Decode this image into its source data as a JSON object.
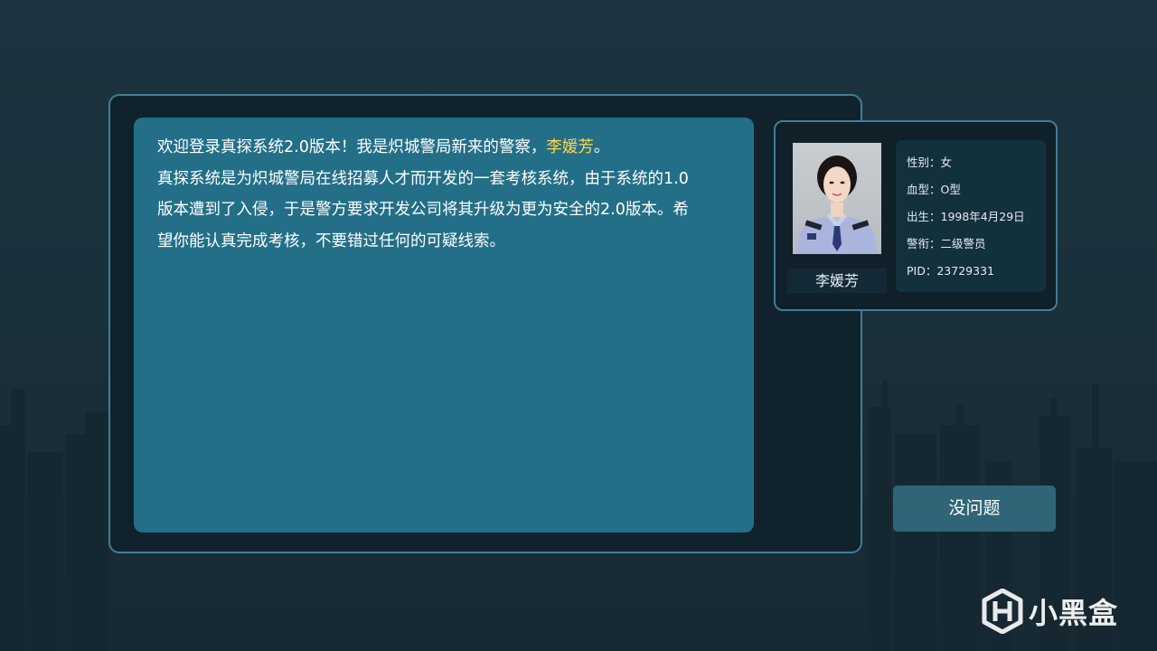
{
  "dialog": {
    "line1_before": "欢迎登录真探系统2.0版本！我是炽城警局新来的警察，",
    "line1_name": "李媛芳",
    "line1_after": "。",
    "line2": "真探系统是为炽城警局在线招募人才而开发的一套考核系统，由于系统的1.0",
    "line3": "版本遭到了入侵，于是警方要求开发公司将其升级为更为安全的2.0版本。希",
    "line4": "望你能认真完成考核，不要错过任何的可疑线索。"
  },
  "profile": {
    "name": "李媛芳",
    "gender": "性别：女",
    "blood": "血型：O型",
    "birth": "出生：1998年4月29日",
    "rank": "警衔：二级警员",
    "pid": "PID：23729331"
  },
  "actions": {
    "confirm_label": "没问题"
  },
  "watermark": {
    "text": "小黑盒"
  },
  "colors": {
    "accent": "#3f7f96",
    "dialog_bg": "#246f88",
    "highlight": "#ffd84a",
    "button_bg": "#2f6577"
  }
}
